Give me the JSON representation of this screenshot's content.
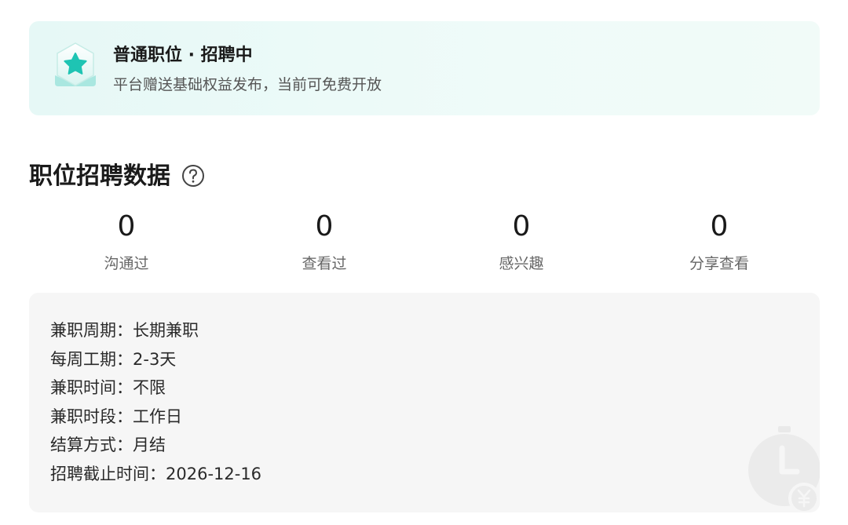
{
  "banner": {
    "title": "普通职位 · 招聘中",
    "subtitle": "平台赠送基础权益发布，当前可免费开放",
    "icon": "star-badge-icon",
    "accent_color": "#2cc4b5"
  },
  "section": {
    "title": "职位招聘数据",
    "help_icon": "question-circle-icon"
  },
  "stats": [
    {
      "value": "0",
      "label": "沟通过"
    },
    {
      "value": "0",
      "label": "查看过"
    },
    {
      "value": "0",
      "label": "感兴趣"
    },
    {
      "value": "0",
      "label": "分享查看"
    }
  ],
  "details": [
    {
      "label": "兼职周期：",
      "value": "长期兼职"
    },
    {
      "label": "每周工期：",
      "value": "2-3天"
    },
    {
      "label": "兼职时间：",
      "value": "不限"
    },
    {
      "label": "兼职时段：",
      "value": "工作日"
    },
    {
      "label": "结算方式：",
      "value": "月结"
    },
    {
      "label": "招聘截止时间：",
      "value": "2026-12-16"
    }
  ],
  "watermark_icon": "clock-yen-icon"
}
